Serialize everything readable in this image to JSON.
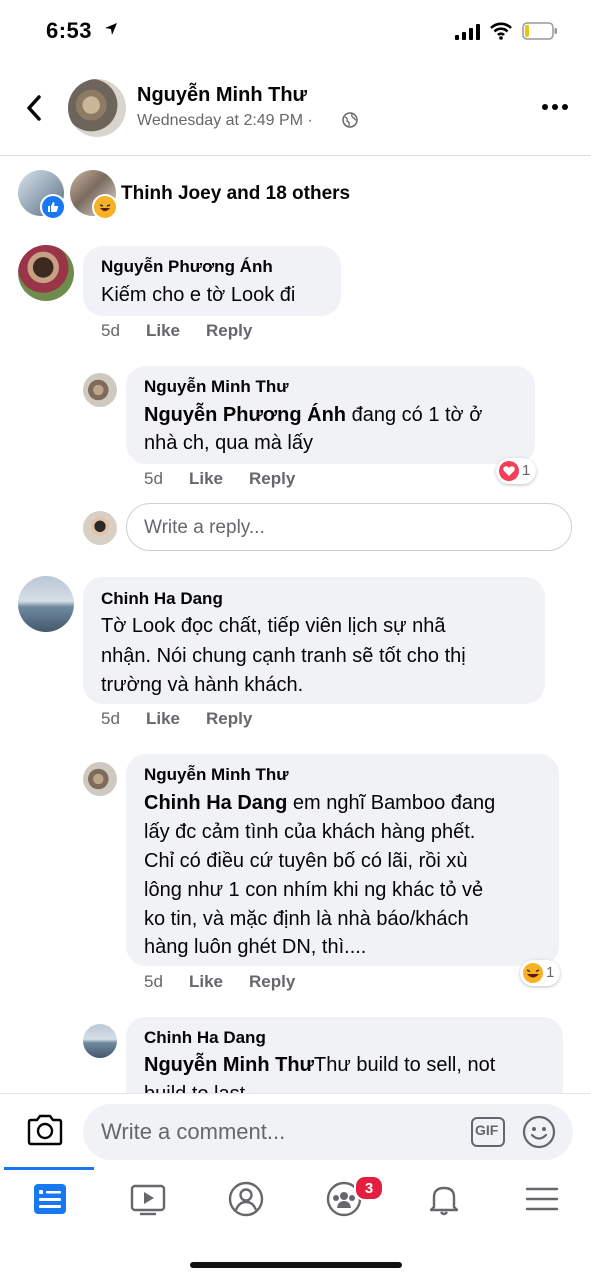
{
  "status_bar": {
    "time": "6:53"
  },
  "header": {
    "name": "Nguyễn Minh Thư",
    "subtitle": "Wednesday at 2:49 PM · ",
    "icons": [
      "back-arrow-icon",
      "globe-icon",
      "more-icon"
    ]
  },
  "reactions": {
    "summary": "Thinh Joey and 18 others"
  },
  "comments": [
    {
      "author": "Nguyễn Phương Ánh",
      "text": "Kiếm cho e tờ Look đi",
      "time": "5d",
      "like": "Like",
      "reply": "Reply",
      "replies": [
        {
          "author": "Nguyễn Minh Thư",
          "mention": "Nguyễn Phương Ánh",
          "text_line1": " đang có 1 tờ ở",
          "text_line2": "nhà ch, qua mà lấy",
          "time": "5d",
          "like": "Like",
          "reply": "Reply",
          "reaction_count": "1"
        }
      ],
      "reply_placeholder": "Write a reply..."
    },
    {
      "author": "Chinh Ha Dang",
      "lines": [
        "Tờ Look đọc chất, tiếp viên lịch sự nhã",
        "nhận. Nói chung cạnh tranh sẽ tốt cho thị",
        "trường và hành khách."
      ],
      "time": "5d",
      "like": "Like",
      "reply": "Reply",
      "replies": [
        {
          "author": "Nguyễn Minh Thư",
          "mention": "Chinh Ha Dang",
          "first_line_rest": " em nghĩ Bamboo đang",
          "lines": [
            "lấy đc cảm tình của khách hàng phết.",
            "Chỉ có điều cứ tuyên bố có lãi, rồi xù",
            "lông như 1 con nhím khi ng khác tỏ vẻ",
            "ko tin, và mặc định là nhà báo/khách",
            "hàng luôn ghét DN, thì...."
          ],
          "time": "5d",
          "like": "Like",
          "reply": "Reply",
          "reaction_count": "1"
        },
        {
          "author": "Chinh Ha Dang",
          "mention": "Nguyễn Minh Thư",
          "first_line_rest": "Thư build to sell, not",
          "line2": "build to last"
        }
      ]
    }
  ],
  "composer": {
    "placeholder": "Write a comment...",
    "gif": "GIF"
  },
  "tabbar": {
    "tabs": [
      "news-feed",
      "watch",
      "profile",
      "groups",
      "notifications",
      "menu"
    ],
    "groups_badge": "3"
  },
  "colors": {
    "accent": "#1877f2",
    "bubble": "#f0f2f5",
    "secondary_text": "#65676b",
    "badge": "#e41e3f"
  }
}
